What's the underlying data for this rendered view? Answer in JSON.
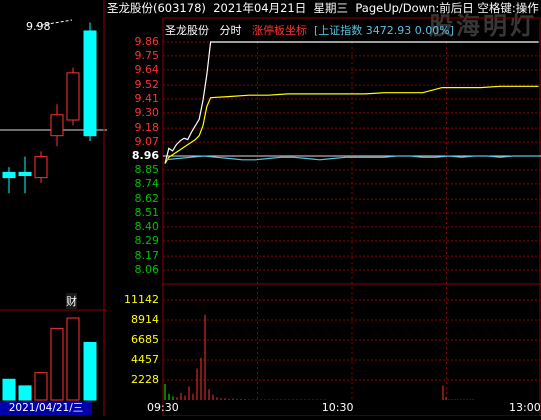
{
  "title": {
    "stock": "圣龙股份(603178)",
    "date": "2021年04月21日",
    "weekday": "星期三",
    "hint": "PageUp/Down:前后日 空格键:操作"
  },
  "watermark": "股海明灯",
  "legend": {
    "name": "圣龙股份",
    "mode": "分时",
    "limit_label": "涨停板坐标",
    "index_label": "[上证指数 3472.93 0.00%]"
  },
  "left_panel": {
    "high_label": "9.98",
    "marker": "财",
    "date_label": "2021/04/21/三"
  },
  "colors": {
    "up": "#ff3232",
    "down": "#00ffff",
    "grid": "#8b0000",
    "price_line": "#ffffff",
    "avg_line": "#ffff00",
    "index_line": "#5bc0de",
    "volume": "#ff3030",
    "neutral": "#ffffff",
    "axis_down": "#00c000"
  },
  "chart_data": [
    {
      "type": "line",
      "title": "分时",
      "y_ticks": [
        "9.86",
        "9.75",
        "9.64",
        "9.52",
        "9.41",
        "9.30",
        "9.18",
        "9.07",
        "8.96",
        "8.85",
        "8.74",
        "8.62",
        "8.51",
        "8.40",
        "8.29",
        "8.17",
        "8.06"
      ],
      "ylim": [
        8.06,
        9.86
      ],
      "prev_close": 8.96,
      "x_ticks": [
        "09:30",
        "10:30",
        "13:00"
      ],
      "series": [
        {
          "name": "price",
          "values": [
            8.9,
            9.02,
            9.0,
            9.05,
            9.08,
            9.1,
            9.09,
            9.15,
            9.2,
            9.25,
            9.4,
            9.6,
            9.86,
            9.86,
            9.86,
            9.86,
            9.86,
            9.86,
            9.86,
            9.86,
            9.86,
            9.86,
            9.86,
            9.86,
            9.86,
            9.86,
            9.86,
            9.86,
            9.86,
            9.86
          ]
        },
        {
          "name": "average",
          "values": [
            8.9,
            8.95,
            8.97,
            8.99,
            9.01,
            9.03,
            9.05,
            9.07,
            9.09,
            9.12,
            9.2,
            9.35,
            9.42,
            9.43,
            9.44,
            9.44,
            9.45,
            9.45,
            9.45,
            9.45,
            9.45,
            9.46,
            9.46,
            9.46,
            9.5,
            9.5,
            9.5,
            9.51,
            9.51,
            9.51
          ]
        },
        {
          "name": "index",
          "values": [
            8.93,
            8.94,
            8.95,
            8.96,
            8.95,
            8.94,
            8.93,
            8.93,
            8.94,
            8.95,
            8.95,
            8.94,
            8.93,
            8.94,
            8.95,
            8.95,
            8.95,
            8.95,
            8.96,
            8.96,
            8.95,
            8.95,
            8.96,
            8.95,
            8.96,
            8.96,
            8.95,
            8.96,
            8.96,
            8.96
          ]
        }
      ]
    },
    {
      "type": "bar",
      "title": "volume",
      "y_ticks": [
        "11142",
        "8914",
        "6685",
        "4457",
        "2228"
      ],
      "ylim": [
        0,
        11142
      ],
      "values": [
        1800,
        700,
        400,
        300,
        800,
        500,
        1500,
        700,
        3500,
        4700,
        9500,
        1200,
        600,
        300,
        200,
        200,
        100,
        150,
        100,
        100,
        100,
        50,
        50,
        50,
        50,
        50,
        50,
        50,
        50,
        50,
        50,
        50,
        50,
        50,
        50,
        50,
        50,
        50,
        50,
        50,
        50,
        1600,
        300,
        50,
        50,
        50,
        50,
        50,
        50,
        50,
        50,
        50
      ]
    },
    {
      "type": "candlestick",
      "title": "daily",
      "ylim": [
        8.0,
        10.1
      ],
      "candles": [
        {
          "o": 8.55,
          "c": 8.5,
          "h": 8.6,
          "l": 8.35
        },
        {
          "o": 8.55,
          "c": 8.52,
          "h": 8.7,
          "l": 8.35
        },
        {
          "o": 8.5,
          "c": 8.7,
          "h": 8.75,
          "l": 8.45
        },
        {
          "o": 8.9,
          "c": 9.1,
          "h": 9.2,
          "l": 8.8
        },
        {
          "o": 9.05,
          "c": 9.5,
          "h": 9.55,
          "l": 9.0
        },
        {
          "o": 9.9,
          "c": 8.9,
          "h": 9.98,
          "l": 8.85
        }
      ],
      "volumes": [
        2200,
        1500,
        2900,
        7600,
        8700,
        6100
      ]
    }
  ]
}
